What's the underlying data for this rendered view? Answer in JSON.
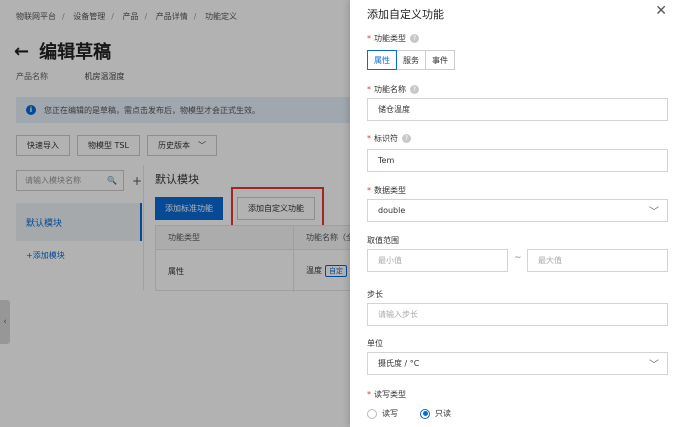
{
  "breadcrumb": [
    "物联网平台",
    "设备管理",
    "产品",
    "产品详情",
    "功能定义"
  ],
  "page": {
    "back_icon": "←",
    "title": "编辑草稿",
    "product_label": "产品名称",
    "product_value": "机房温湿度"
  },
  "notice": {
    "icon": "i",
    "text": "您正在编辑的是草稿，需点击发布后，物模型才会正式生效。"
  },
  "toolbar": {
    "quick_import": "快速导入",
    "tsl": "物模型 TSL",
    "history": "历史版本",
    "history_caret": "﹀"
  },
  "sidebar": {
    "search_placeholder": "请输入模块名称",
    "search_icon": "🔍",
    "plus": "+",
    "module": "默认模块",
    "add_module": "+添加模块"
  },
  "main": {
    "section_title": "默认模块",
    "add_standard": "添加标准功能",
    "add_custom": "添加自定义功能",
    "table": {
      "headers": [
        "功能类型",
        "功能名称（全"
      ],
      "row": {
        "type": "属性",
        "name": "温度",
        "tag": "自定"
      }
    }
  },
  "side_handle": "‹",
  "drawer": {
    "title": "添加自定义功能",
    "close": "✕",
    "function_type": {
      "label": "功能类型",
      "options": [
        "属性",
        "服务",
        "事件"
      ],
      "selected": "属性"
    },
    "function_name": {
      "label": "功能名称",
      "value": "储仓温度"
    },
    "identifier": {
      "label": "标识符",
      "value": "Tem"
    },
    "data_type": {
      "label": "数据类型",
      "value": "double"
    },
    "range": {
      "label": "取值范围",
      "min_placeholder": "最小值",
      "sep": "~",
      "max_placeholder": "最大值"
    },
    "step": {
      "label": "步长",
      "placeholder": "请输入步长"
    },
    "unit": {
      "label": "单位",
      "value": "摄氏度 / °C"
    },
    "rw": {
      "label": "读写类型",
      "options": [
        "读写",
        "只读"
      ],
      "selected": "只读"
    },
    "required_mark": "*",
    "help_icon": "?",
    "chevron": "﹀"
  }
}
